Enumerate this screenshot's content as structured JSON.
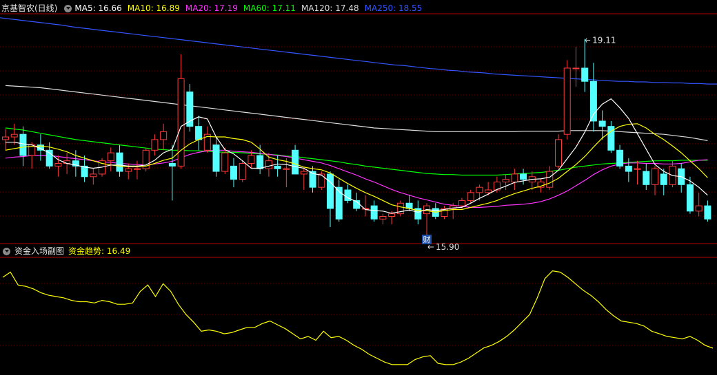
{
  "main_legend": {
    "title": "京基智农(日线)",
    "items": [
      {
        "label": "MA5: 16.66",
        "color": "#ffffff"
      },
      {
        "label": "MA10: 16.89",
        "color": "#ffff00"
      },
      {
        "label": "MA20: 17.19",
        "color": "#ff33ff"
      },
      {
        "label": "MA60: 17.11",
        "color": "#00ff00"
      },
      {
        "label": "MA120: 17.48",
        "color": "#dddddd"
      },
      {
        "label": "MA250: 18.55",
        "color": "#3355ff"
      }
    ]
  },
  "sub_legend": {
    "title": "资金入场副图",
    "items": [
      {
        "label": "资金趋势: 16.49",
        "color": "#ffff00"
      }
    ]
  },
  "annotations": {
    "high": "19.11",
    "low": "15.90",
    "marker": "财"
  },
  "colors": {
    "up": "#ff3b3b",
    "down": "#54ffff",
    "grid": "#6a0000",
    "frame": "#b00000"
  },
  "chart_data": {
    "type": "candlestick",
    "y_range": [
      15.55,
      19.85
    ],
    "candles": [
      [
        17.5,
        17.7,
        17.3,
        17.55
      ],
      [
        17.55,
        17.8,
        17.4,
        17.6
      ],
      [
        17.6,
        17.75,
        17.0,
        17.2
      ],
      [
        17.2,
        17.45,
        16.95,
        17.4
      ],
      [
        17.4,
        17.6,
        17.1,
        17.3
      ],
      [
        17.3,
        17.45,
        16.95,
        17.0
      ],
      [
        17.0,
        17.2,
        16.8,
        17.05
      ],
      [
        17.05,
        17.25,
        16.85,
        17.1
      ],
      [
        17.1,
        17.3,
        16.8,
        17.0
      ],
      [
        17.0,
        17.2,
        16.7,
        16.8
      ],
      [
        16.8,
        16.95,
        16.65,
        16.85
      ],
      [
        16.85,
        17.15,
        16.8,
        17.1
      ],
      [
        17.1,
        17.35,
        16.9,
        17.25
      ],
      [
        17.25,
        17.4,
        16.8,
        16.9
      ],
      [
        16.9,
        17.05,
        16.75,
        16.95
      ],
      [
        16.95,
        17.1,
        16.75,
        16.95
      ],
      [
        16.95,
        17.35,
        16.9,
        17.3
      ],
      [
        17.3,
        17.6,
        17.2,
        17.5
      ],
      [
        17.5,
        17.8,
        17.3,
        17.65
      ],
      [
        17.05,
        17.4,
        16.35,
        17.0
      ],
      [
        17.0,
        19.11,
        16.95,
        18.65
      ],
      [
        18.4,
        18.55,
        17.65,
        17.75
      ],
      [
        17.75,
        17.95,
        17.3,
        17.5
      ],
      [
        17.3,
        17.75,
        17.25,
        17.6
      ],
      [
        17.4,
        17.55,
        16.8,
        16.9
      ],
      [
        16.9,
        17.35,
        16.85,
        17.25
      ],
      [
        17.0,
        17.15,
        16.6,
        16.75
      ],
      [
        16.75,
        17.1,
        16.7,
        17.05
      ],
      [
        17.05,
        17.3,
        16.95,
        17.2
      ],
      [
        17.2,
        17.4,
        16.85,
        16.95
      ],
      [
        16.95,
        17.25,
        16.8,
        17.1
      ],
      [
        17.0,
        17.2,
        16.8,
        16.95
      ],
      [
        16.95,
        17.15,
        16.6,
        16.95
      ],
      [
        17.3,
        17.4,
        16.85,
        16.85
      ],
      [
        16.85,
        16.95,
        16.55,
        16.9
      ],
      [
        16.9,
        17.0,
        16.5,
        16.6
      ],
      [
        16.6,
        16.9,
        16.55,
        16.85
      ],
      [
        16.85,
        16.9,
        15.85,
        16.2
      ],
      [
        16.6,
        16.75,
        15.95,
        16.0
      ],
      [
        16.55,
        16.65,
        16.3,
        16.35
      ],
      [
        16.35,
        16.5,
        16.15,
        16.2
      ],
      [
        16.2,
        16.45,
        16.05,
        16.2
      ],
      [
        16.25,
        16.35,
        15.95,
        16.0
      ],
      [
        16.0,
        16.1,
        15.9,
        16.05
      ],
      [
        16.05,
        16.15,
        15.9,
        16.1
      ],
      [
        16.1,
        16.35,
        16.05,
        16.3
      ],
      [
        16.3,
        16.45,
        16.15,
        16.2
      ],
      [
        16.2,
        16.35,
        15.9,
        16.0
      ],
      [
        16.1,
        16.3,
        15.55,
        16.25
      ],
      [
        16.2,
        16.3,
        16.0,
        16.05
      ],
      [
        16.05,
        16.25,
        16.0,
        16.2
      ],
      [
        16.2,
        16.3,
        16.0,
        16.25
      ],
      [
        16.25,
        16.4,
        16.2,
        16.35
      ],
      [
        16.35,
        16.55,
        16.3,
        16.5
      ],
      [
        16.5,
        16.65,
        16.35,
        16.6
      ],
      [
        16.5,
        16.7,
        16.45,
        16.55
      ],
      [
        16.55,
        16.8,
        16.5,
        16.7
      ],
      [
        16.7,
        16.85,
        16.55,
        16.75
      ],
      [
        16.7,
        16.95,
        16.55,
        16.85
      ],
      [
        16.85,
        16.95,
        16.65,
        16.75
      ],
      [
        16.7,
        16.9,
        16.55,
        16.8
      ],
      [
        16.6,
        16.75,
        16.5,
        16.7
      ],
      [
        16.6,
        17.0,
        16.55,
        16.9
      ],
      [
        17.0,
        17.6,
        16.95,
        17.5
      ],
      [
        17.6,
        19.0,
        17.5,
        18.85
      ],
      [
        18.85,
        19.25,
        18.5,
        18.85
      ],
      [
        18.85,
        19.4,
        18.4,
        18.6
      ],
      [
        18.6,
        18.95,
        17.65,
        17.85
      ],
      [
        17.85,
        18.05,
        17.5,
        17.75
      ],
      [
        17.75,
        17.85,
        17.25,
        17.3
      ],
      [
        17.3,
        17.4,
        16.95,
        17.0
      ],
      [
        17.0,
        17.15,
        16.7,
        16.9
      ],
      [
        16.95,
        17.1,
        16.65,
        16.95
      ],
      [
        16.9,
        17.05,
        16.55,
        16.65
      ],
      [
        16.65,
        17.0,
        16.45,
        16.95
      ],
      [
        16.85,
        16.95,
        16.45,
        16.65
      ],
      [
        16.65,
        17.1,
        16.6,
        17.0
      ],
      [
        16.95,
        17.05,
        16.5,
        16.65
      ],
      [
        16.65,
        16.8,
        16.1,
        16.15
      ],
      [
        16.15,
        16.5,
        16.05,
        16.25
      ],
      [
        16.25,
        16.35,
        15.95,
        16.0
      ]
    ],
    "ma5": [
      17.45,
      17.45,
      17.42,
      17.4,
      17.33,
      17.25,
      17.12,
      17.05,
      17.02,
      16.98,
      16.96,
      16.98,
      17.02,
      17.02,
      17.0,
      17.0,
      17.02,
      17.11,
      17.25,
      17.32,
      17.75,
      17.85,
      17.93,
      17.89,
      17.55,
      17.31,
      17.23,
      17.1,
      16.96,
      16.96,
      17.0,
      17.04,
      17.03,
      16.99,
      16.96,
      16.86,
      16.83,
      16.7,
      16.52,
      16.4,
      16.33,
      16.18,
      16.16,
      16.15,
      16.11,
      16.14,
      16.17,
      16.13,
      16.18,
      16.16,
      16.18,
      16.21,
      16.22,
      16.3,
      16.39,
      16.47,
      16.56,
      16.62,
      16.69,
      16.72,
      16.75,
      16.76,
      16.79,
      16.92,
      17.14,
      17.36,
      17.64,
      17.98,
      18.17,
      18.27,
      18.1,
      17.9,
      17.61,
      17.32,
      17.03,
      16.9,
      16.82,
      16.8,
      16.72,
      16.6,
      16.45
    ],
    "ma10": [
      17.3,
      17.33,
      17.36,
      17.37,
      17.38,
      17.36,
      17.32,
      17.27,
      17.2,
      17.15,
      17.1,
      17.05,
      17.02,
      17.0,
      16.99,
      16.99,
      17.0,
      17.05,
      17.11,
      17.15,
      17.3,
      17.42,
      17.5,
      17.56,
      17.55,
      17.55,
      17.52,
      17.5,
      17.45,
      17.32,
      17.17,
      17.12,
      17.09,
      17.04,
      16.98,
      16.95,
      16.93,
      16.87,
      16.77,
      16.67,
      16.58,
      16.5,
      16.43,
      16.35,
      16.27,
      16.23,
      16.2,
      16.16,
      16.16,
      16.13,
      16.16,
      16.18,
      16.18,
      16.22,
      16.26,
      16.3,
      16.35,
      16.42,
      16.48,
      16.53,
      16.58,
      16.62,
      16.68,
      16.77,
      16.9,
      17.03,
      17.18,
      17.36,
      17.53,
      17.66,
      17.75,
      17.79,
      17.8,
      17.72,
      17.6,
      17.5,
      17.38,
      17.25,
      17.1,
      16.95,
      16.78
    ],
    "ma20": [
      17.15,
      17.17,
      17.18,
      17.2,
      17.2,
      17.2,
      17.18,
      17.16,
      17.14,
      17.12,
      17.1,
      17.08,
      17.07,
      17.05,
      17.04,
      17.03,
      17.02,
      17.04,
      17.06,
      17.09,
      17.16,
      17.22,
      17.26,
      17.29,
      17.3,
      17.3,
      17.28,
      17.27,
      17.26,
      17.24,
      17.22,
      17.2,
      17.18,
      17.15,
      17.12,
      17.09,
      17.06,
      17.01,
      16.95,
      16.89,
      16.83,
      16.76,
      16.7,
      16.63,
      16.56,
      16.5,
      16.45,
      16.4,
      16.36,
      16.32,
      16.28,
      16.26,
      16.24,
      16.22,
      16.22,
      16.23,
      16.24,
      16.26,
      16.27,
      16.28,
      16.3,
      16.33,
      16.38,
      16.45,
      16.53,
      16.63,
      16.73,
      16.84,
      16.93,
      17.0,
      17.04,
      17.06,
      17.06,
      17.05,
      17.05,
      17.04,
      17.04,
      17.05,
      17.08,
      17.11,
      17.12
    ],
    "ma60": [
      17.72,
      17.7,
      17.68,
      17.65,
      17.62,
      17.59,
      17.56,
      17.53,
      17.5,
      17.48,
      17.46,
      17.44,
      17.42,
      17.4,
      17.38,
      17.36,
      17.34,
      17.32,
      17.31,
      17.3,
      17.3,
      17.29,
      17.29,
      17.28,
      17.27,
      17.26,
      17.26,
      17.25,
      17.24,
      17.23,
      17.22,
      17.21,
      17.19,
      17.18,
      17.16,
      17.14,
      17.12,
      17.1,
      17.08,
      17.05,
      17.03,
      17.0,
      16.98,
      16.96,
      16.94,
      16.92,
      16.9,
      16.88,
      16.86,
      16.85,
      16.84,
      16.84,
      16.83,
      16.83,
      16.83,
      16.83,
      16.83,
      16.84,
      16.85,
      16.86,
      16.87,
      16.88,
      16.9,
      16.92,
      16.95,
      16.98,
      17.0,
      17.02,
      17.04,
      17.05,
      17.06,
      17.07,
      17.08,
      17.09,
      17.1,
      17.1,
      17.1,
      17.11,
      17.11,
      17.11,
      17.11
    ],
    "ma120": [
      18.52,
      18.51,
      18.5,
      18.49,
      18.48,
      18.46,
      18.44,
      18.42,
      18.4,
      18.38,
      18.36,
      18.34,
      18.32,
      18.3,
      18.28,
      18.26,
      18.24,
      18.22,
      18.2,
      18.18,
      18.16,
      18.14,
      18.12,
      18.1,
      18.08,
      18.06,
      18.04,
      18.02,
      18.0,
      17.98,
      17.96,
      17.94,
      17.92,
      17.9,
      17.88,
      17.86,
      17.84,
      17.82,
      17.8,
      17.78,
      17.76,
      17.74,
      17.72,
      17.71,
      17.7,
      17.69,
      17.68,
      17.67,
      17.66,
      17.65,
      17.65,
      17.65,
      17.65,
      17.65,
      17.65,
      17.65,
      17.65,
      17.65,
      17.65,
      17.66,
      17.66,
      17.66,
      17.66,
      17.66,
      17.67,
      17.67,
      17.67,
      17.67,
      17.67,
      17.66,
      17.65,
      17.64,
      17.63,
      17.62,
      17.61,
      17.6,
      17.58,
      17.56,
      17.54,
      17.51,
      17.48
    ],
    "ma250": [
      19.8,
      19.78,
      19.76,
      19.74,
      19.72,
      19.7,
      19.68,
      19.66,
      19.63,
      19.61,
      19.59,
      19.57,
      19.55,
      19.53,
      19.51,
      19.49,
      19.47,
      19.45,
      19.43,
      19.41,
      19.39,
      19.37,
      19.35,
      19.33,
      19.31,
      19.29,
      19.27,
      19.25,
      19.23,
      19.21,
      19.19,
      19.17,
      19.15,
      19.13,
      19.11,
      19.09,
      19.07,
      19.05,
      19.03,
      19.01,
      18.99,
      18.97,
      18.95,
      18.93,
      18.91,
      18.9,
      18.88,
      18.86,
      18.84,
      18.83,
      18.81,
      18.8,
      18.78,
      18.77,
      18.76,
      18.74,
      18.73,
      18.72,
      18.71,
      18.7,
      18.69,
      18.68,
      18.67,
      18.66,
      18.65,
      18.64,
      18.63,
      18.62,
      18.61,
      18.6,
      18.6,
      18.59,
      18.59,
      18.58,
      18.58,
      18.57,
      18.57,
      18.56,
      18.56,
      18.55,
      18.55
    ],
    "sub_range": [
      15.5,
      20.0
    ],
    "fund_trend": [
      19.25,
      19.45,
      18.95,
      18.9,
      18.8,
      18.65,
      18.55,
      18.5,
      18.45,
      18.35,
      18.3,
      18.3,
      18.25,
      18.35,
      18.3,
      18.2,
      18.2,
      18.25,
      18.7,
      18.95,
      18.5,
      19.0,
      18.7,
      18.2,
      17.8,
      17.5,
      17.15,
      17.2,
      17.15,
      17.05,
      17.1,
      17.2,
      17.3,
      17.3,
      17.45,
      17.55,
      17.4,
      17.25,
      17.05,
      16.85,
      16.95,
      16.8,
      17.15,
      16.9,
      16.95,
      16.8,
      16.6,
      16.45,
      16.25,
      16.1,
      15.95,
      15.85,
      15.85,
      15.85,
      16.05,
      16.15,
      16.2,
      15.9,
      15.85,
      15.85,
      15.95,
      16.1,
      16.3,
      16.5,
      16.6,
      16.75,
      16.95,
      17.2,
      17.5,
      17.8,
      18.45,
      19.2,
      19.5,
      19.45,
      19.25,
      19.0,
      18.75,
      18.55,
      18.3,
      18.0,
      17.75,
      17.55,
      17.5,
      17.45,
      17.35,
      17.15,
      17.05,
      16.95,
      16.9,
      16.85,
      16.95,
      16.8,
      16.6,
      16.49
    ]
  }
}
